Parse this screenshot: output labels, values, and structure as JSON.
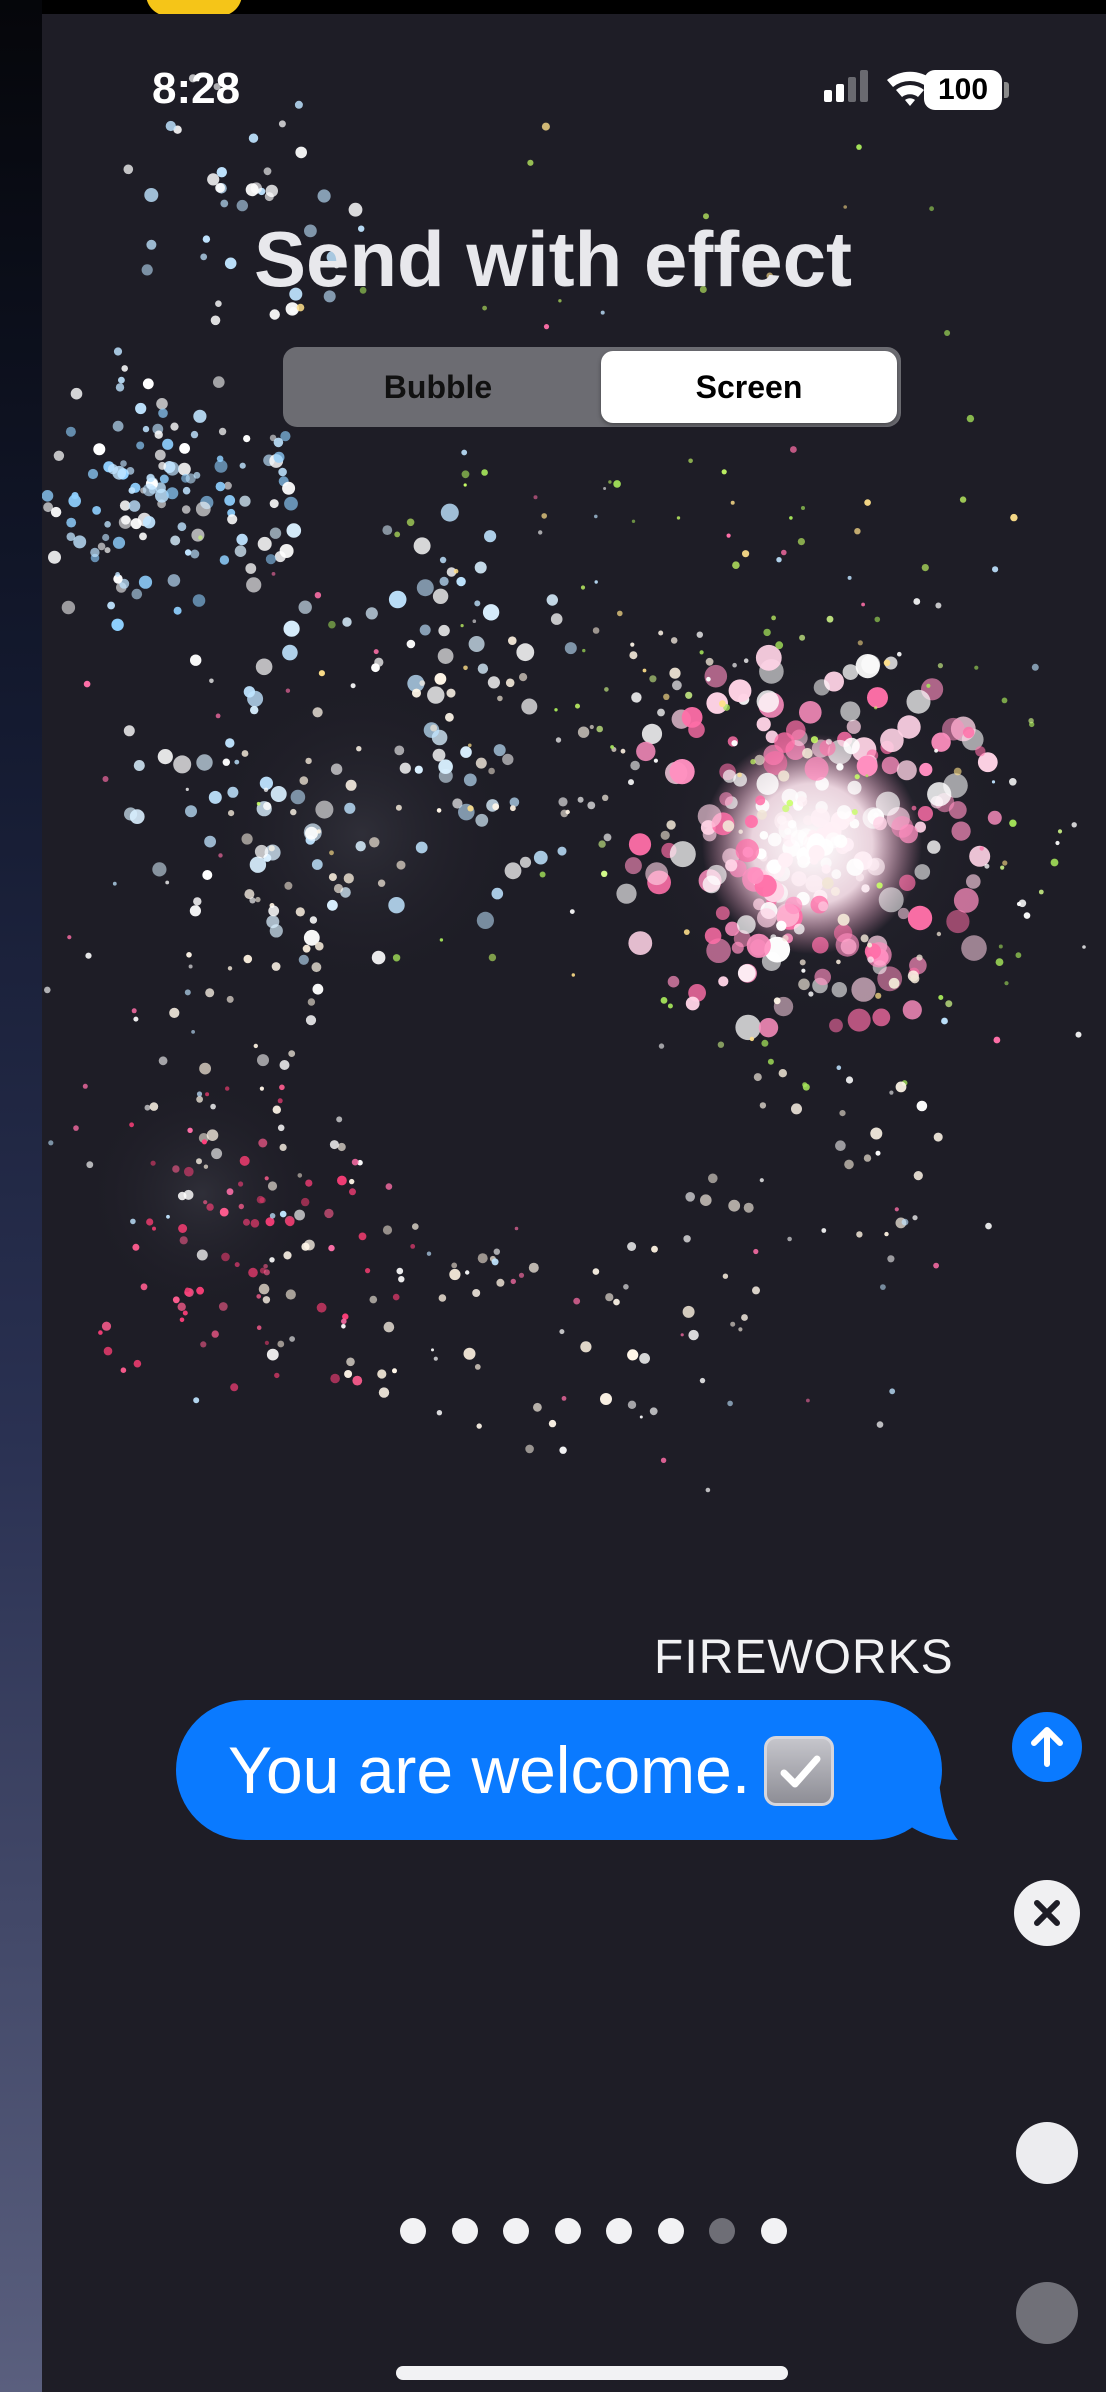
{
  "status_bar": {
    "time": "8:28",
    "battery": "100",
    "icons": [
      "cellular-signal-icon",
      "wifi-icon",
      "battery-icon"
    ]
  },
  "header": {
    "title": "Send with effect"
  },
  "effect_tabs": {
    "options": [
      "Bubble",
      "Screen"
    ],
    "selected": "Screen"
  },
  "effect": {
    "name": "FIREWORKS"
  },
  "message": {
    "text": "You are welcome.",
    "emoji": "check-mark-button-icon"
  },
  "controls": {
    "send_icon": "arrow-up-icon",
    "cancel_icon": "close-icon"
  },
  "pagination": {
    "count": 8,
    "active_index": 6
  },
  "colors": {
    "bubble": "#0a7aff",
    "background": "#1e1d26",
    "segment_track": "#6c6c72",
    "firework_pink": "#ff8fc0",
    "firework_blue": "#bfe4ff",
    "firework_green": "#a6e65a"
  }
}
